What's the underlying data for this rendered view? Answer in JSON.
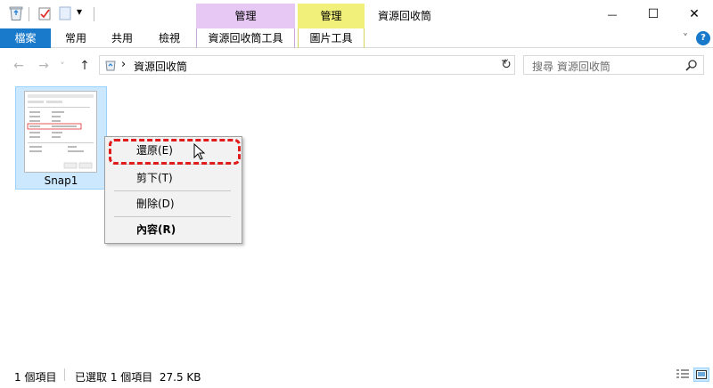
{
  "quick_access": {
    "dropdown_glyph": "▾"
  },
  "title": {
    "ctx_tab_manage_purple": "管理",
    "ctx_tab_manage_yellow": "管理",
    "window_title": "資源回收筒"
  },
  "window_controls": {
    "minimize": "—",
    "maximize": "☐",
    "close": "✕"
  },
  "ribbon": {
    "tabs": [
      {
        "label": "檔案"
      },
      {
        "label": "常用"
      },
      {
        "label": "共用"
      },
      {
        "label": "檢視"
      },
      {
        "label": "資源回收筒工具"
      },
      {
        "label": "圖片工具"
      }
    ],
    "expand_glyph": "˅",
    "help_glyph": "?"
  },
  "nav": {
    "back": "←",
    "forward": "→",
    "recent_glyph": "˅",
    "up": "↑"
  },
  "address": {
    "chevron": "›",
    "path": "資源回收筒",
    "dropdown_glyph": "˅",
    "refresh_glyph": "↻"
  },
  "search": {
    "placeholder": "搜尋 資源回收筒"
  },
  "files": [
    {
      "name": "Snap1"
    }
  ],
  "context_menu": {
    "restore": "還原(E)",
    "cut": "剪下(T)",
    "delete": "刪除(D)",
    "properties": "內容(R)"
  },
  "status": {
    "item_count": "1 個項目",
    "selection": "已選取 1 個項目  27.5 KB"
  },
  "colors": {
    "file_tab": "#1979ca",
    "ctx_purple": "#e7c8f4",
    "ctx_yellow": "#f1f07a",
    "selection": "#cce8ff",
    "highlight": "#e01b1b"
  }
}
